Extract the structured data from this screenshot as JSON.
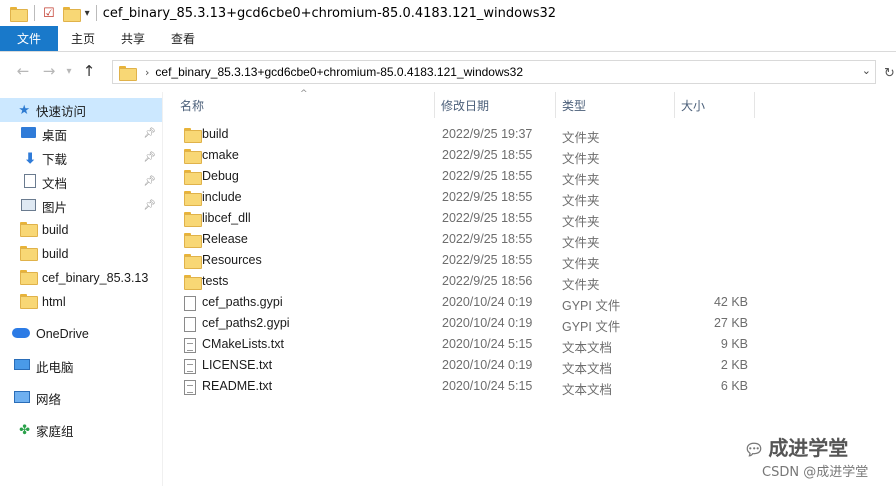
{
  "window": {
    "title": "cef_binary_85.3.13+gcd6cbe0+chromium-85.0.4183.121_windows32"
  },
  "ribbon": {
    "tabs": [
      "文件",
      "主页",
      "共享",
      "查看"
    ]
  },
  "address": {
    "path": "cef_binary_85.3.13+gcd6cbe0+chromium-85.0.4183.121_windows32"
  },
  "sidebar": {
    "items": [
      {
        "label": "快速访问",
        "icon": "star-icon",
        "selected": true
      },
      {
        "label": "桌面",
        "icon": "desktop-icon",
        "pinned": true
      },
      {
        "label": "下载",
        "icon": "download-icon",
        "pinned": true
      },
      {
        "label": "文档",
        "icon": "documents-icon",
        "pinned": true
      },
      {
        "label": "图片",
        "icon": "pictures-icon",
        "pinned": true
      },
      {
        "label": "build",
        "icon": "folder-icon"
      },
      {
        "label": "build",
        "icon": "folder-icon"
      },
      {
        "label": "cef_binary_85.3.13",
        "icon": "folder-icon"
      },
      {
        "label": "html",
        "icon": "folder-icon"
      },
      {
        "label": "OneDrive",
        "icon": "onedrive-icon"
      },
      {
        "label": "此电脑",
        "icon": "this-pc-icon"
      },
      {
        "label": "网络",
        "icon": "network-icon"
      },
      {
        "label": "家庭组",
        "icon": "homegroup-icon"
      }
    ]
  },
  "columns": {
    "name": "名称",
    "date": "修改日期",
    "type": "类型",
    "size": "大小"
  },
  "files": [
    {
      "name": "build",
      "date": "2022/9/25 19:37",
      "type": "文件夹",
      "size": "",
      "icon": "folder-icon"
    },
    {
      "name": "cmake",
      "date": "2022/9/25 18:55",
      "type": "文件夹",
      "size": "",
      "icon": "folder-icon"
    },
    {
      "name": "Debug",
      "date": "2022/9/25 18:55",
      "type": "文件夹",
      "size": "",
      "icon": "folder-icon"
    },
    {
      "name": "include",
      "date": "2022/9/25 18:55",
      "type": "文件夹",
      "size": "",
      "icon": "folder-icon"
    },
    {
      "name": "libcef_dll",
      "date": "2022/9/25 18:55",
      "type": "文件夹",
      "size": "",
      "icon": "folder-icon"
    },
    {
      "name": "Release",
      "date": "2022/9/25 18:55",
      "type": "文件夹",
      "size": "",
      "icon": "folder-icon"
    },
    {
      "name": "Resources",
      "date": "2022/9/25 18:55",
      "type": "文件夹",
      "size": "",
      "icon": "folder-icon"
    },
    {
      "name": "tests",
      "date": "2022/9/25 18:56",
      "type": "文件夹",
      "size": "",
      "icon": "folder-icon"
    },
    {
      "name": "cef_paths.gypi",
      "date": "2020/10/24 0:19",
      "type": "GYPI 文件",
      "size": "42 KB",
      "icon": "file-icon"
    },
    {
      "name": "cef_paths2.gypi",
      "date": "2020/10/24 0:19",
      "type": "GYPI 文件",
      "size": "27 KB",
      "icon": "file-icon"
    },
    {
      "name": "CMakeLists.txt",
      "date": "2020/10/24 5:15",
      "type": "文本文档",
      "size": "9 KB",
      "icon": "text-file-icon"
    },
    {
      "name": "LICENSE.txt",
      "date": "2020/10/24 0:19",
      "type": "文本文档",
      "size": "2 KB",
      "icon": "text-file-icon"
    },
    {
      "name": "README.txt",
      "date": "2020/10/24 5:15",
      "type": "文本文档",
      "size": "6 KB",
      "icon": "text-file-icon"
    }
  ],
  "watermark": {
    "line1": "成进学堂",
    "line2": "CSDN @成进学堂"
  },
  "colors": {
    "accent": "#1979ca",
    "selected": "#cce8ff",
    "folder": "#f8d775"
  }
}
